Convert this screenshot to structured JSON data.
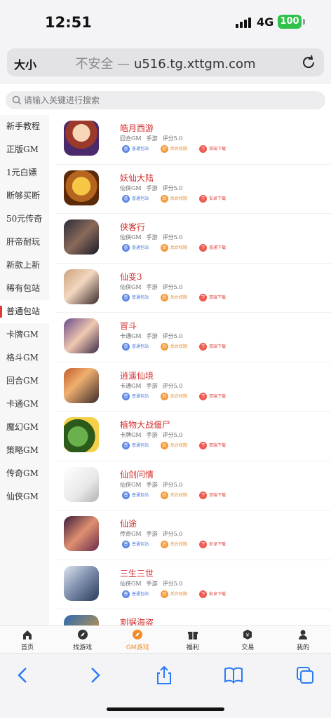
{
  "status": {
    "time": "12:51",
    "network": "4G",
    "battery": "100"
  },
  "browser": {
    "text_size": "大小",
    "insecure": "不安全 —",
    "domain": "u516.tg.xttgm.com"
  },
  "search": {
    "placeholder": "请输入关键进行搜索"
  },
  "categories": [
    "新手教程",
    "正版GM",
    "1元白嫖",
    "断够买断",
    "50元传奇",
    "肝帝耐玩",
    "新款上新",
    "稀有包站",
    "普通包站",
    "卡牌GM",
    "格斗GM",
    "回合GM",
    "卡通GM",
    "魔幻GM",
    "策略GM",
    "传奇GM",
    "仙侠GM"
  ],
  "active_category": "普通包站",
  "games": [
    {
      "name": "皓月西游",
      "genre": "回合GM",
      "platform": "手游",
      "rating": "评分5.0",
      "tags": [
        "普通包站",
        "后台权限",
        "双端下载"
      ]
    },
    {
      "name": "妖仙大陆",
      "genre": "仙侠GM",
      "platform": "手游",
      "rating": "评分5.0",
      "tags": [
        "普通包站",
        "后台权限",
        "安卓下载"
      ]
    },
    {
      "name": "侠客行",
      "genre": "仙侠GM",
      "platform": "手游",
      "rating": "评分5.0",
      "tags": [
        "普通包站",
        "后台权限",
        "普通下载"
      ]
    },
    {
      "name": "仙变3",
      "genre": "仙侠GM",
      "platform": "手游",
      "rating": "评分5.0",
      "tags": [
        "普通包站",
        "后台权限",
        "双端下载"
      ]
    },
    {
      "name": "冒斗",
      "genre": "卡通GM",
      "platform": "手游",
      "rating": "评分5.0",
      "tags": [
        "普通包站",
        "后台权限",
        "双端下载"
      ]
    },
    {
      "name": "逍遥仙境",
      "genre": "卡通GM",
      "platform": "手游",
      "rating": "评分5.0",
      "tags": [
        "普通包站",
        "后台权限",
        "双端下载"
      ]
    },
    {
      "name": "植物大战僵尸",
      "genre": "卡牌GM",
      "platform": "手游",
      "rating": "评分5.0",
      "tags": [
        "普通包站",
        "后台权限",
        "双端下载"
      ]
    },
    {
      "name": "仙剑问情",
      "genre": "仙侠GM",
      "platform": "手游",
      "rating": "评分5.0",
      "tags": [
        "普通包站",
        "后台权限",
        "双端下载"
      ]
    },
    {
      "name": "仙途",
      "genre": "传奇GM",
      "platform": "手游",
      "rating": "评分5.0",
      "tags": [
        "普通包站",
        "后台权限",
        "安卓下载"
      ]
    },
    {
      "name": "三生三世",
      "genre": "仙侠GM",
      "platform": "手游",
      "rating": "评分5.0",
      "tags": [
        "普通包站",
        "后台权限",
        "安卓下载"
      ]
    },
    {
      "name": "割据海盗",
      "genre": "",
      "platform": "",
      "rating": "",
      "tags": []
    }
  ],
  "tabs": [
    "首页",
    "找游戏",
    "GM游戏",
    "福利",
    "交易",
    "我的"
  ],
  "active_tab": "GM游戏",
  "colors": {
    "accent": "#f28c28",
    "title_red": "#d32f2f",
    "battery": "#2ec24a"
  }
}
